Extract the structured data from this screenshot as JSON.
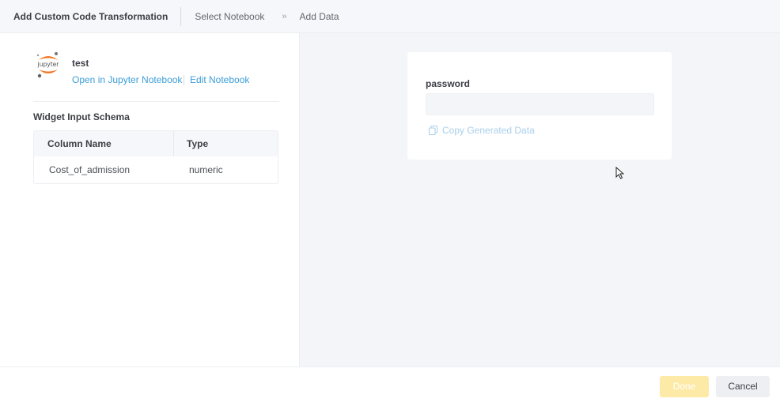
{
  "header": {
    "title": "Add Custom Code Transformation",
    "breadcrumbs": [
      "Select Notebook",
      "Add Data"
    ],
    "separator": "»"
  },
  "notebook": {
    "logo_text": "jupyter",
    "name": "test",
    "open_link": "Open in Jupyter Notebook",
    "edit_link": "Edit Notebook"
  },
  "schema": {
    "title": "Widget Input Schema",
    "columns": [
      "Column Name",
      "Type"
    ],
    "rows": [
      {
        "name": "Cost_of_admission",
        "type": "numeric"
      }
    ]
  },
  "form": {
    "field_label": "password",
    "field_value": "",
    "copy_label": "Copy Generated Data"
  },
  "footer": {
    "done_label": "Done",
    "cancel_label": "Cancel"
  },
  "colors": {
    "accent_link": "#3c9ed9",
    "done_disabled": "#fdeaa6",
    "jupyter_orange": "#f37726"
  }
}
